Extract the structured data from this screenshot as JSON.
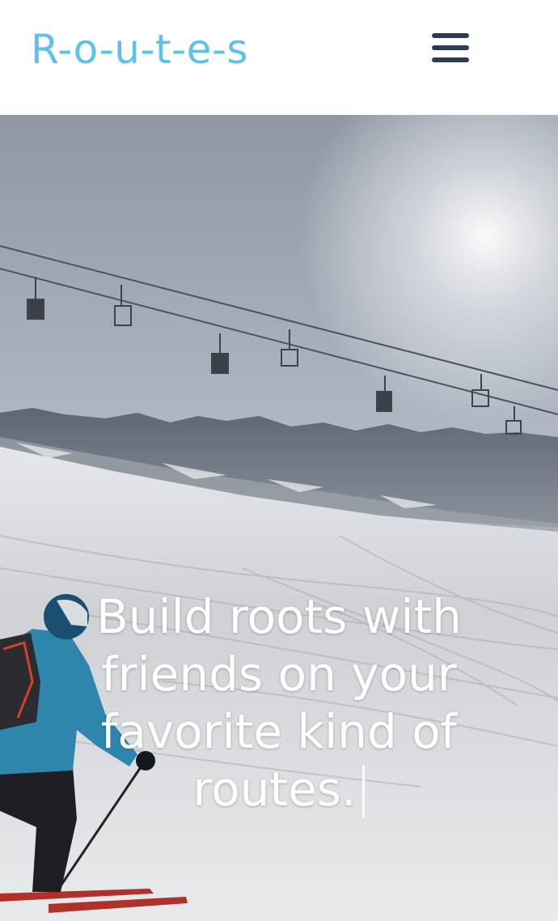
{
  "header": {
    "logo_text": "R-o-u-t-e-s",
    "menu_icon": "hamburger-menu-icon"
  },
  "hero": {
    "scene": "skier-on-slope-with-chairlift",
    "tagline": "Build roots with friends on your favorite kind of routes."
  },
  "colors": {
    "logo": "#5ec0ec",
    "menu_icon": "#2e3b55",
    "tagline": "#ffffff"
  }
}
